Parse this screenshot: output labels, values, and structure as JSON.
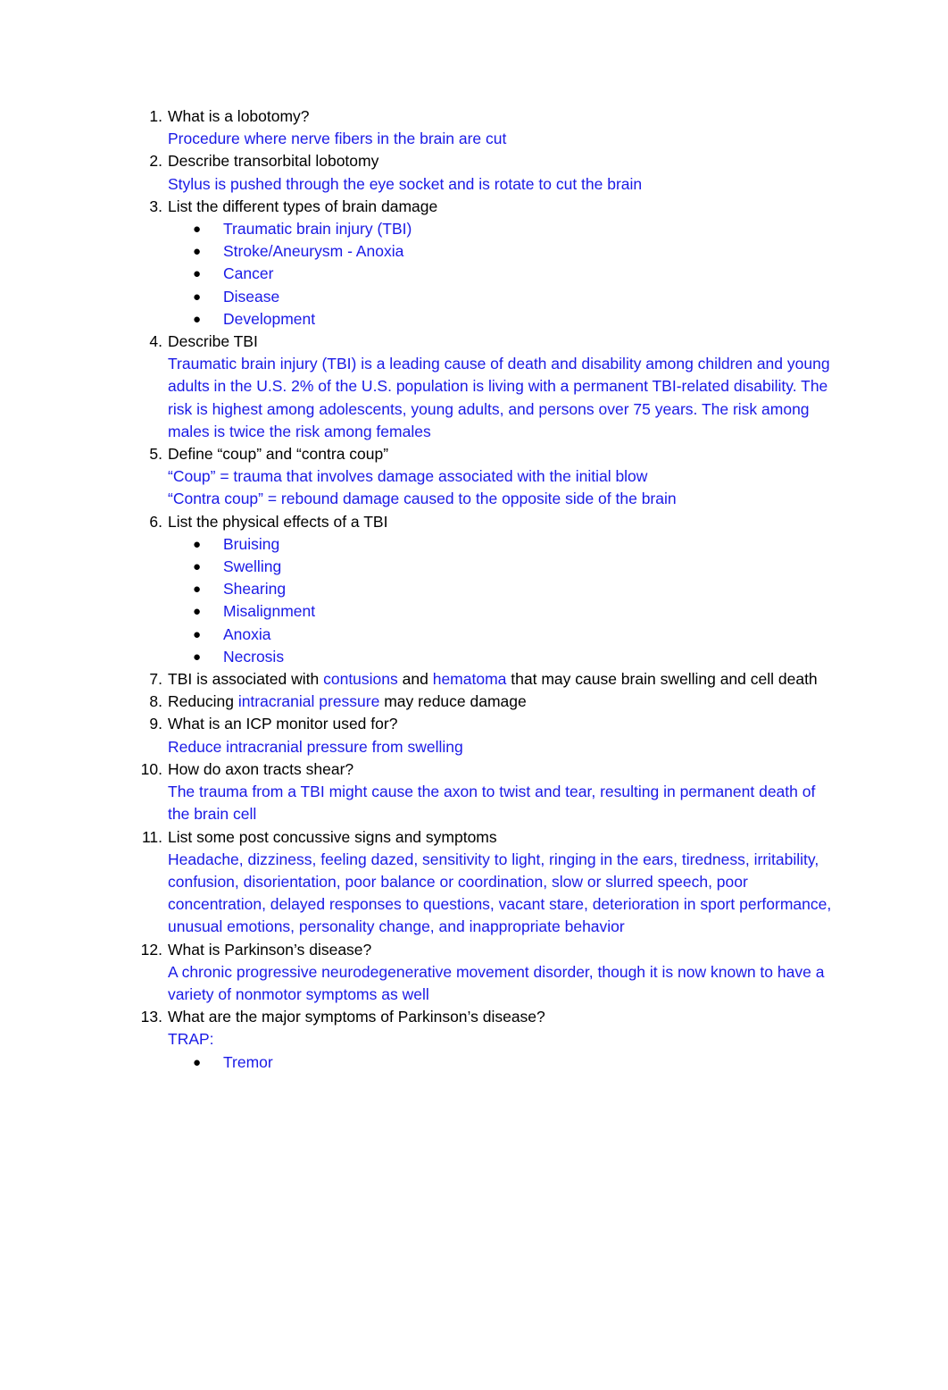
{
  "document": {
    "text_color": "#000000",
    "answer_color": "#1a1ae6",
    "background": "#ffffff",
    "bullet_glyph": "●"
  },
  "items": [
    {
      "number": "1.",
      "question": "What is a lobotomy?",
      "answers": [
        "Procedure where nerve fibers in the brain are cut"
      ],
      "bullets": []
    },
    {
      "number": "2.",
      "question": "Describe transorbital lobotomy",
      "answers": [
        "Stylus is pushed through the eye socket and is rotate to cut the brain"
      ],
      "bullets": []
    },
    {
      "number": "3.",
      "question": "List the different types of brain damage",
      "answers": [],
      "bullets": [
        "Traumatic brain injury (TBI)",
        "Stroke/Aneurysm - Anoxia",
        "Cancer",
        "Disease",
        "Development"
      ]
    },
    {
      "number": "4.",
      "question": "Describe TBI",
      "answers": [
        "Traumatic brain injury (TBI) is a leading cause of death and disability among children and young adults in the U.S. 2% of the U.S. population is living with a permanent TBI-related disability. The risk is highest among adolescents, young adults, and persons over 75 years. The risk among males is twice the risk among females"
      ],
      "bullets": []
    },
    {
      "number": "5.",
      "question": "Define “coup” and “contra coup”",
      "answers": [
        "“Coup” = trauma that involves damage associated with the initial blow",
        "“Contra coup” = rebound damage caused to the opposite side of the brain"
      ],
      "bullets": []
    },
    {
      "number": "6.",
      "question": "List the physical effects of a TBI",
      "answers": [],
      "bullets": [
        "Bruising",
        "Swelling",
        "Shearing",
        "Misalignment",
        "Anoxia",
        "Necrosis"
      ]
    },
    {
      "number": "7.",
      "question_parts": [
        {
          "text": "TBI is associated with ",
          "color": "black"
        },
        {
          "text": "contusions",
          "color": "blue"
        },
        {
          "text": " and ",
          "color": "black"
        },
        {
          "text": "hematoma",
          "color": "blue"
        },
        {
          "text": " that may cause brain swelling and cell death",
          "color": "black"
        }
      ],
      "answers": [],
      "bullets": []
    },
    {
      "number": "8.",
      "question_parts": [
        {
          "text": "Reducing ",
          "color": "black"
        },
        {
          "text": "intracranial pressure",
          "color": "blue"
        },
        {
          "text": " may reduce damage",
          "color": "black"
        }
      ],
      "answers": [],
      "bullets": []
    },
    {
      "number": "9.",
      "question": "What is an ICP monitor used for?",
      "answers": [
        "Reduce intracranial pressure from swelling"
      ],
      "bullets": []
    },
    {
      "number": "10.",
      "question": "How do axon tracts shear?",
      "answers": [
        "The trauma from a TBI might cause the axon to twist and tear, resulting in permanent death of the brain cell"
      ],
      "bullets": []
    },
    {
      "number": "11.",
      "question": "List some post concussive signs and symptoms",
      "answers": [
        "Headache, dizziness, feeling dazed, sensitivity to light, ringing in the ears, tiredness, irritability, confusion, disorientation, poor balance or coordination, slow or slurred speech, poor concentration, delayed responses to questions, vacant stare, deterioration in sport performance, unusual emotions, personality change, and inappropriate behavior"
      ],
      "bullets": []
    },
    {
      "number": "12.",
      "question": "What is Parkinson’s disease?",
      "answers": [
        "A chronic progressive neurodegenerative movement disorder, though it is now known to have a variety of nonmotor symptoms as well"
      ],
      "bullets": []
    },
    {
      "number": "13.",
      "question": "What are the major symptoms of Parkinson’s disease?",
      "answers": [
        "TRAP:"
      ],
      "bullets": [
        "Tremor"
      ]
    }
  ]
}
